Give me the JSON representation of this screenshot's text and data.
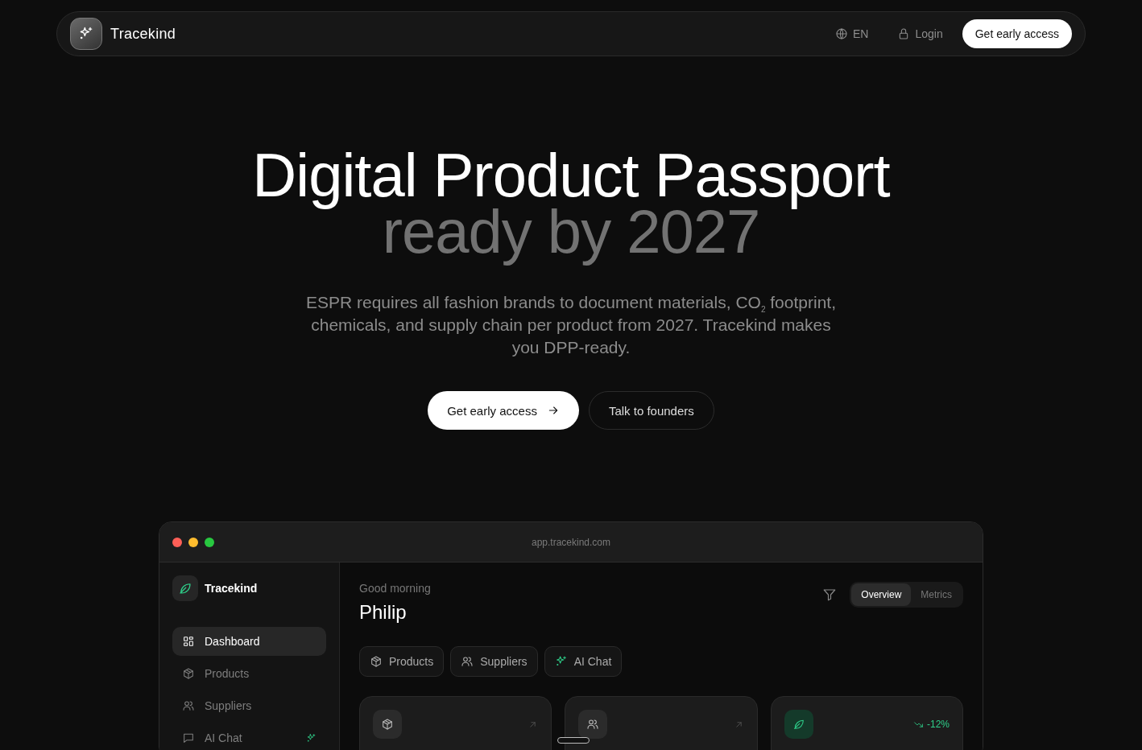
{
  "nav": {
    "brand": "Tracekind",
    "language": "EN",
    "login": "Login",
    "cta": "Get early access"
  },
  "hero": {
    "title_line_1": "Digital Product Passport",
    "title_line_2": "ready by 2027",
    "subtitle": "ESPR requires all fashion brands to document materials, CO$_{2}$ footprint, chemicals, and supply chain per product from 2027. Tracekind makes you DPP-ready.",
    "buttons": [
      {
        "label": "Get early access",
        "kind": "primary"
      },
      {
        "label": "Talk to founders",
        "kind": "secondary"
      }
    ]
  },
  "app": {
    "url": "app.tracekind.com",
    "sidebar": {
      "brand": "Tracekind",
      "items": [
        {
          "label": "Dashboard",
          "kind": "dashboard",
          "selected": true,
          "sparkle": false
        },
        {
          "label": "Products",
          "kind": "products",
          "selected": false,
          "sparkle": false
        },
        {
          "label": "Suppliers",
          "kind": "suppliers",
          "selected": false,
          "sparkle": false
        },
        {
          "label": "AI Chat",
          "kind": "chat",
          "selected": false,
          "sparkle": true
        }
      ]
    },
    "greeting": "Good morning",
    "user_name": "Philip",
    "view_toggle": [
      {
        "label": "Overview",
        "selected": true
      },
      {
        "label": "Metrics",
        "selected": false
      }
    ],
    "quick_actions": [
      {
        "label": "Products",
        "kind": "products"
      },
      {
        "label": "Suppliers",
        "kind": "suppliers"
      },
      {
        "label": "AI Chat",
        "kind": "ai"
      }
    ],
    "stat_cards": [
      {
        "kind": "products"
      },
      {
        "kind": "suppliers"
      },
      {
        "kind": "carbon",
        "trend": "-12%"
      }
    ]
  }
}
